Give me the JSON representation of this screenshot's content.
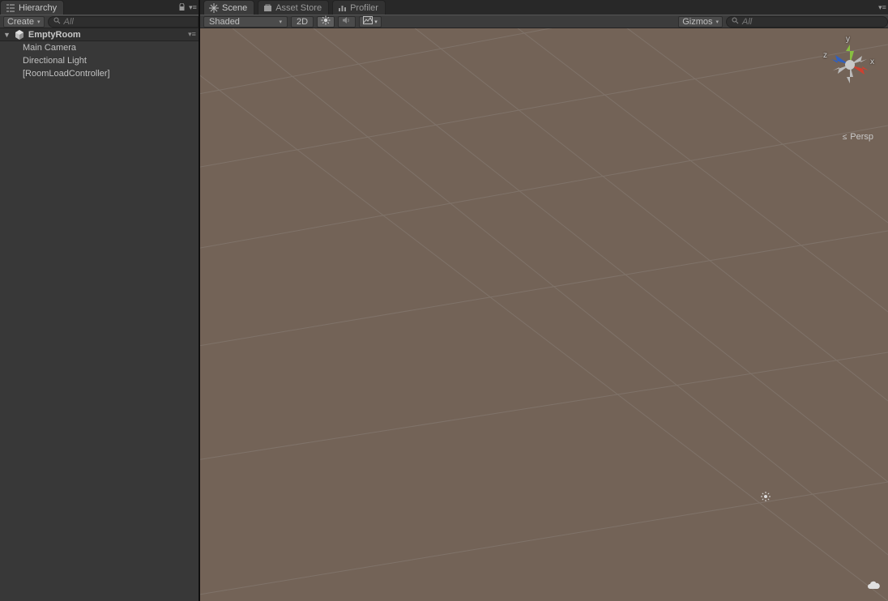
{
  "hierarchy": {
    "tab_label": "Hierarchy",
    "create_label": "Create",
    "search_placeholder": "All",
    "scene_name": "EmptyRoom",
    "items": [
      "Main Camera",
      "Directional Light",
      "[RoomLoadController]"
    ]
  },
  "scene_tabs": {
    "scene": "Scene",
    "asset_store": "Asset Store",
    "profiler": "Profiler"
  },
  "scene_toolbar": {
    "shaded": "Shaded",
    "mode_2d": "2D",
    "gizmos": "Gizmos",
    "search_placeholder": "All"
  },
  "view": {
    "projection": "Persp",
    "axes": {
      "x": "x",
      "y": "y",
      "z": "z"
    }
  }
}
